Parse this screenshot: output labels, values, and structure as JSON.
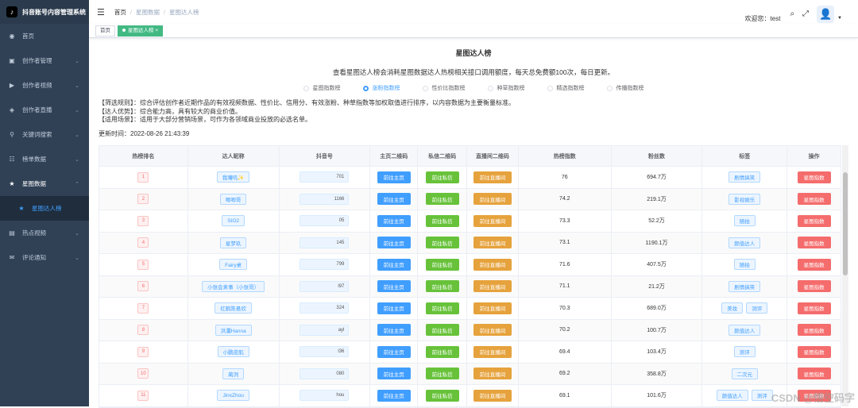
{
  "app": {
    "title": "抖音账号内容管理系统"
  },
  "sidebar": {
    "items": [
      {
        "label": "首页",
        "icon": "dashboard-icon"
      },
      {
        "label": "创作者管理",
        "icon": "creator-icon"
      },
      {
        "label": "创作者视频",
        "icon": "video-icon"
      },
      {
        "label": "创作者直播",
        "icon": "live-icon"
      },
      {
        "label": "关键词搜索",
        "icon": "search-icon"
      },
      {
        "label": "榜单数据",
        "icon": "list-icon"
      },
      {
        "label": "星图数据",
        "icon": "star-icon"
      },
      {
        "label": "星图达人榜",
        "icon": "star-icon"
      },
      {
        "label": "热点视频",
        "icon": "hot-video-icon"
      },
      {
        "label": "评论通知",
        "icon": "comment-icon"
      }
    ]
  },
  "navbar": {
    "breadcrumb": [
      "首页",
      "星图数据",
      "星图达人榜"
    ],
    "welcome": "欢迎您：test"
  },
  "tags": [
    "首页",
    "星图达人榜"
  ],
  "page": {
    "title": "星图达人榜",
    "subtitle": "查看星图达人榜会消耗星图数据达人热榜相关接口调用额度，每天总免费额100次，每日更新。",
    "radios": [
      "星图指数榜",
      "涨粉指数榜",
      "性价比指数榜",
      "种草指数榜",
      "精选指数榜",
      "传播指数榜"
    ],
    "selected_radio": "涨粉指数榜",
    "rules": [
      "【筛选规则】：综合评估创作者近期作品的有效视频数据、性价比、信用分、有效涨粉、种草指数等加权取值进行排序，以内容数据为主要衡量标准。",
      "【达人优势】：综合能力高，具有较大的商业价值。",
      "【适用场景】：适用于大部分营销场景，可作为各领域商业投放的必选名单。"
    ],
    "update_time": "更新时间：2022-08-26 21:43:39"
  },
  "table": {
    "headers": [
      "热榜排名",
      "达人昵称",
      "抖音号",
      "主页二维码",
      "私信二维码",
      "直播间二维码",
      "热榜指数",
      "粉丝数",
      "标签",
      "操作"
    ],
    "btn_home": "前往主页",
    "btn_dm": "前往私信",
    "btn_live": "前往直播间",
    "btn_op": "星图指数",
    "rows": [
      {
        "rank": "1",
        "name": "我嘈叽✨",
        "dy": "701",
        "index": "76",
        "fans": "694.7万",
        "tags": [
          "剧情搞笑"
        ]
      },
      {
        "rank": "2",
        "name": "唧唧哥",
        "dy": "1166",
        "index": "74.2",
        "fans": "219.1万",
        "tags": [
          "影视娱乐"
        ]
      },
      {
        "rank": "3",
        "name": "SIO2",
        "dy": "05",
        "index": "73.3",
        "fans": "52.2万",
        "tags": [
          "随拍"
        ]
      },
      {
        "rank": "4",
        "name": "星梦玖",
        "dy": "145",
        "index": "73.1",
        "fans": "1190.1万",
        "tags": [
          "颜值达人"
        ]
      },
      {
        "rank": "5",
        "name": "Fairy桌",
        "dy": "799",
        "index": "71.6",
        "fans": "407.5万",
        "tags": [
          "随拍"
        ]
      },
      {
        "rank": "6",
        "name": "小张会来事（小张哥）",
        "dy": "l97",
        "index": "71.1",
        "fans": "21.2万",
        "tags": [
          "剧情搞笑"
        ]
      },
      {
        "rank": "7",
        "name": "红鹤陈悬欣",
        "dy": "324",
        "index": "70.3",
        "fans": "689.0万",
        "tags": [
          "美妆",
          "测评"
        ]
      },
      {
        "rank": "8",
        "name": "洪瀾Hanna",
        "dy": "ayl",
        "index": "70.2",
        "fans": "100.7万",
        "tags": [
          "颜值达人"
        ]
      },
      {
        "rank": "9",
        "name": "小鹏皮肌",
        "dy": "l36",
        "index": "69.4",
        "fans": "103.4万",
        "tags": [
          "测评"
        ]
      },
      {
        "rank": "10",
        "name": "蔺冽",
        "dy": "080",
        "index": "69.2",
        "fans": "358.8万",
        "tags": [
          "二次元"
        ]
      },
      {
        "rank": "11",
        "name": "JinxZhou",
        "dy": "hou",
        "index": "69.1",
        "fans": "101.6万",
        "tags": [
          "颜值达人",
          "测评"
        ]
      }
    ]
  },
  "watermark": "CSDN @悟空码字"
}
